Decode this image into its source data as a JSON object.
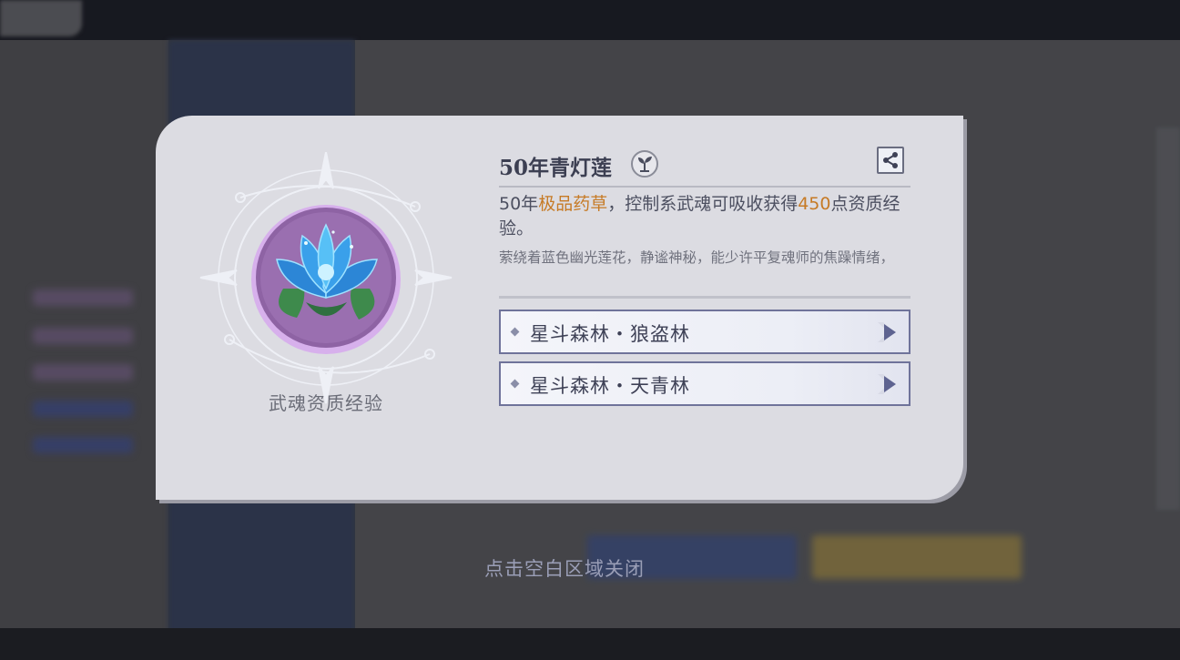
{
  "item": {
    "name": "50年青灯莲",
    "category_icon": "herb-sprout-icon",
    "share_icon": "share-icon",
    "image_icon": "blue-lotus-icon",
    "type_caption": "武魂资质经验",
    "desc": {
      "part1": "50年",
      "highlight1": "极品药草",
      "part2": "，控制系武魂可吸收获得",
      "highlight2": "450",
      "part3": "点资质经验。"
    },
    "flavor": "萦绕着蓝色幽光莲花，静谧神秘，能少许平复魂师的焦躁情绪，"
  },
  "locations": [
    {
      "label": "星斗森林・狼盗林"
    },
    {
      "label": "星斗森林・天青林"
    }
  ],
  "close_hint": "点击空白区域关闭",
  "colors": {
    "highlight": "#c67a25",
    "frame": "#6f739a",
    "panel": "#dcdce2"
  }
}
